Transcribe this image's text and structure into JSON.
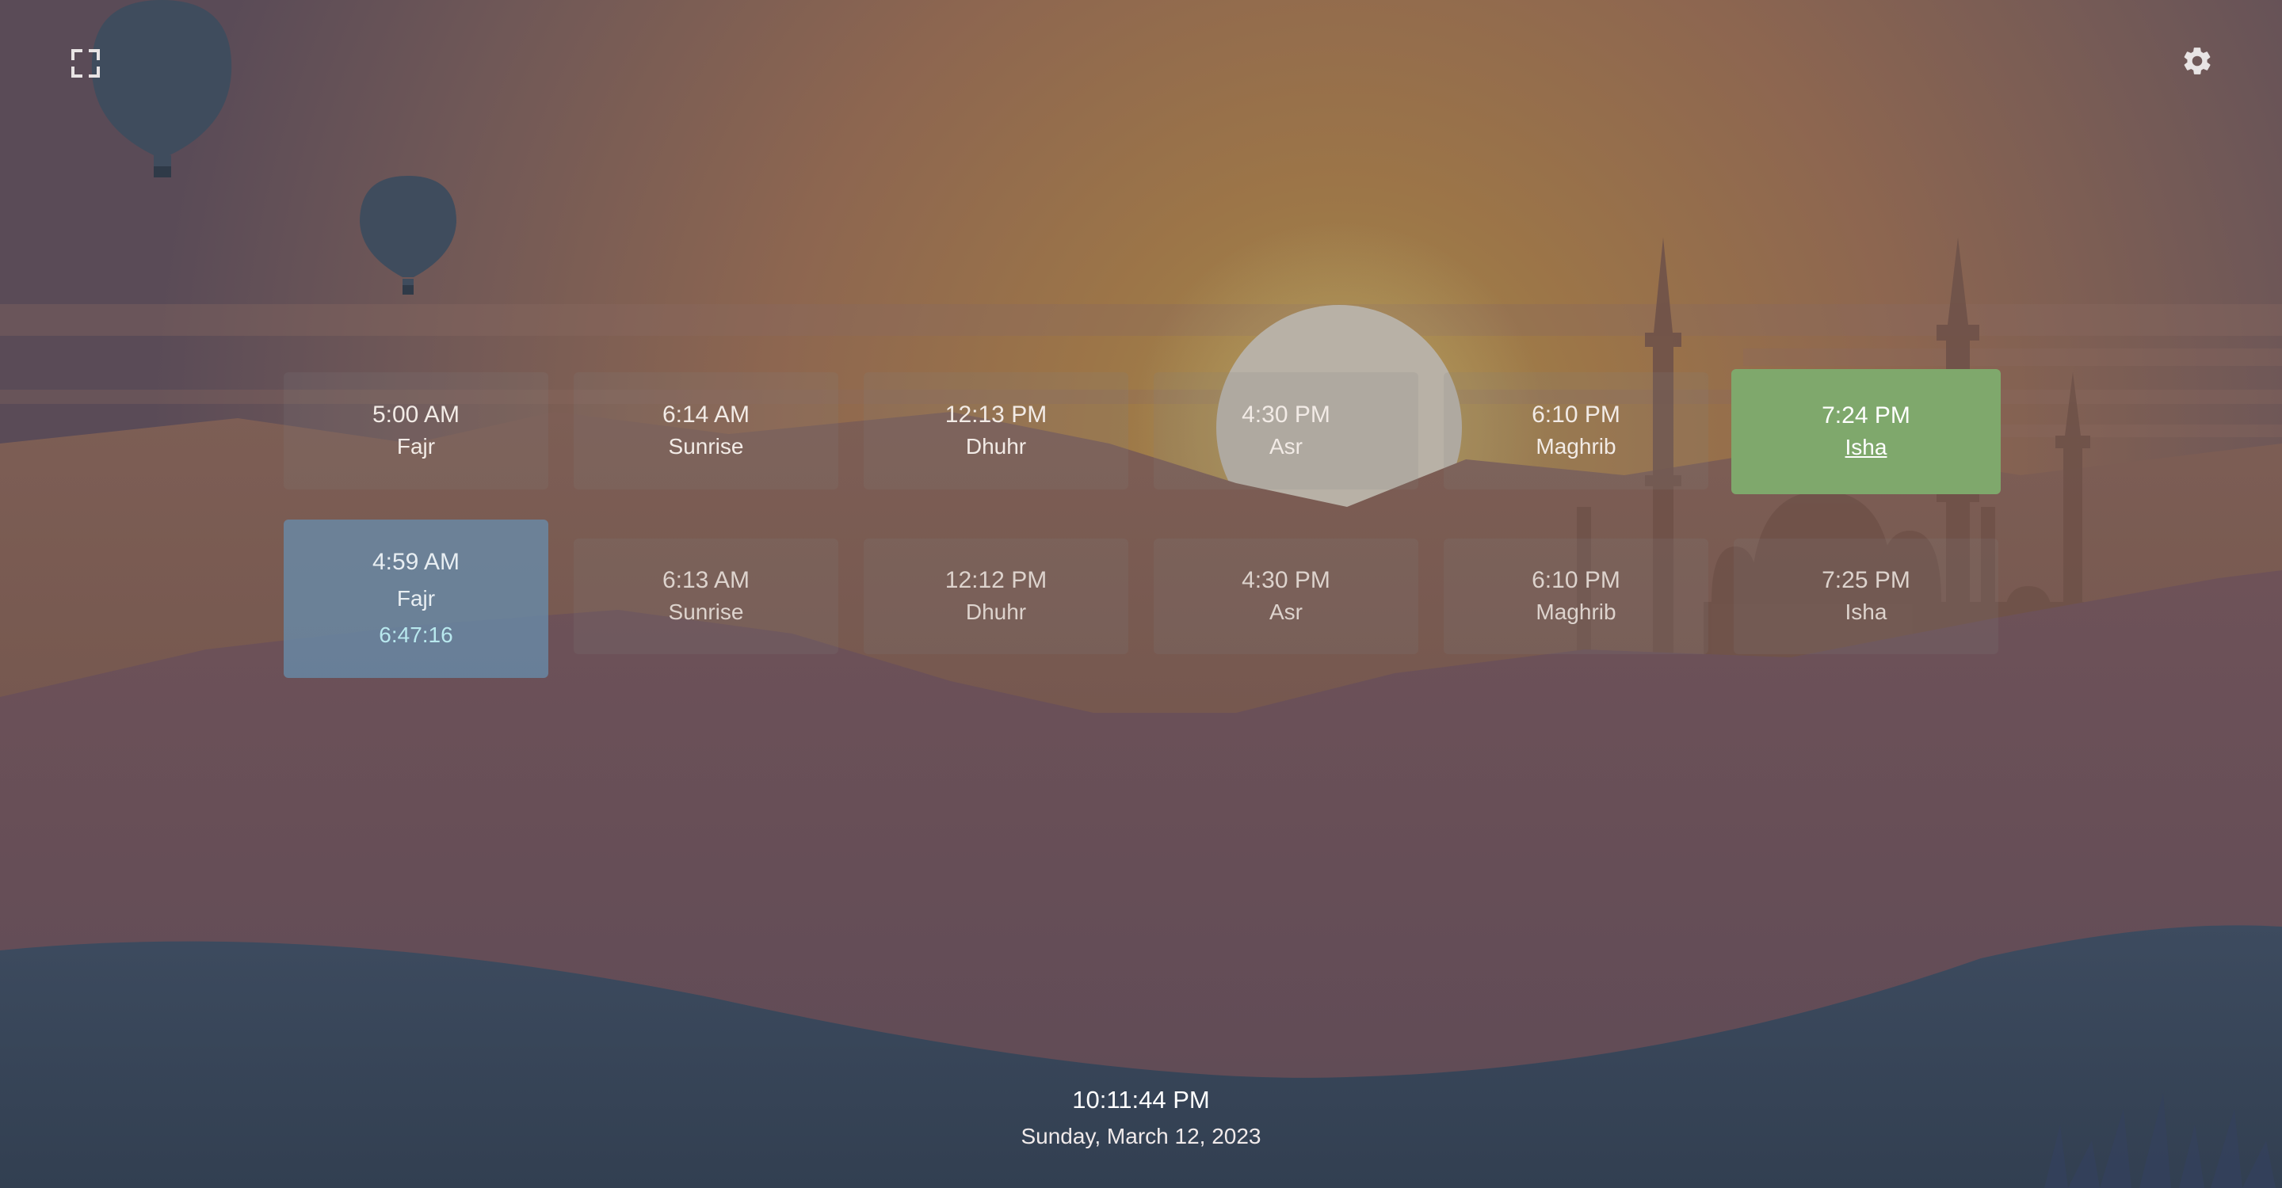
{
  "controls": {
    "fullscreen_icon": "fullscreen-icon",
    "settings_icon": "gear-icon"
  },
  "today": [
    {
      "time": "5:00 AM",
      "name": "Fajr"
    },
    {
      "time": "6:14 AM",
      "name": "Sunrise"
    },
    {
      "time": "12:13 PM",
      "name": "Dhuhr"
    },
    {
      "time": "4:30 PM",
      "name": "Asr"
    },
    {
      "time": "6:10 PM",
      "name": "Maghrib"
    },
    {
      "time": "7:24 PM",
      "name": "Isha"
    }
  ],
  "tomorrow": [
    {
      "time": "4:59 AM",
      "name": "Fajr",
      "countdown": "6:47:16"
    },
    {
      "time": "6:13 AM",
      "name": "Sunrise"
    },
    {
      "time": "12:12 PM",
      "name": "Dhuhr"
    },
    {
      "time": "4:30 PM",
      "name": "Asr"
    },
    {
      "time": "6:10 PM",
      "name": "Maghrib"
    },
    {
      "time": "7:25 PM",
      "name": "Isha"
    }
  ],
  "clock": {
    "time": "10:11:44 PM",
    "date": "Sunday, March 12, 2023"
  },
  "colors": {
    "active_prayer": "#7fa86c",
    "next_prayer": "#688caa",
    "countdown": "#b8e8ee"
  }
}
